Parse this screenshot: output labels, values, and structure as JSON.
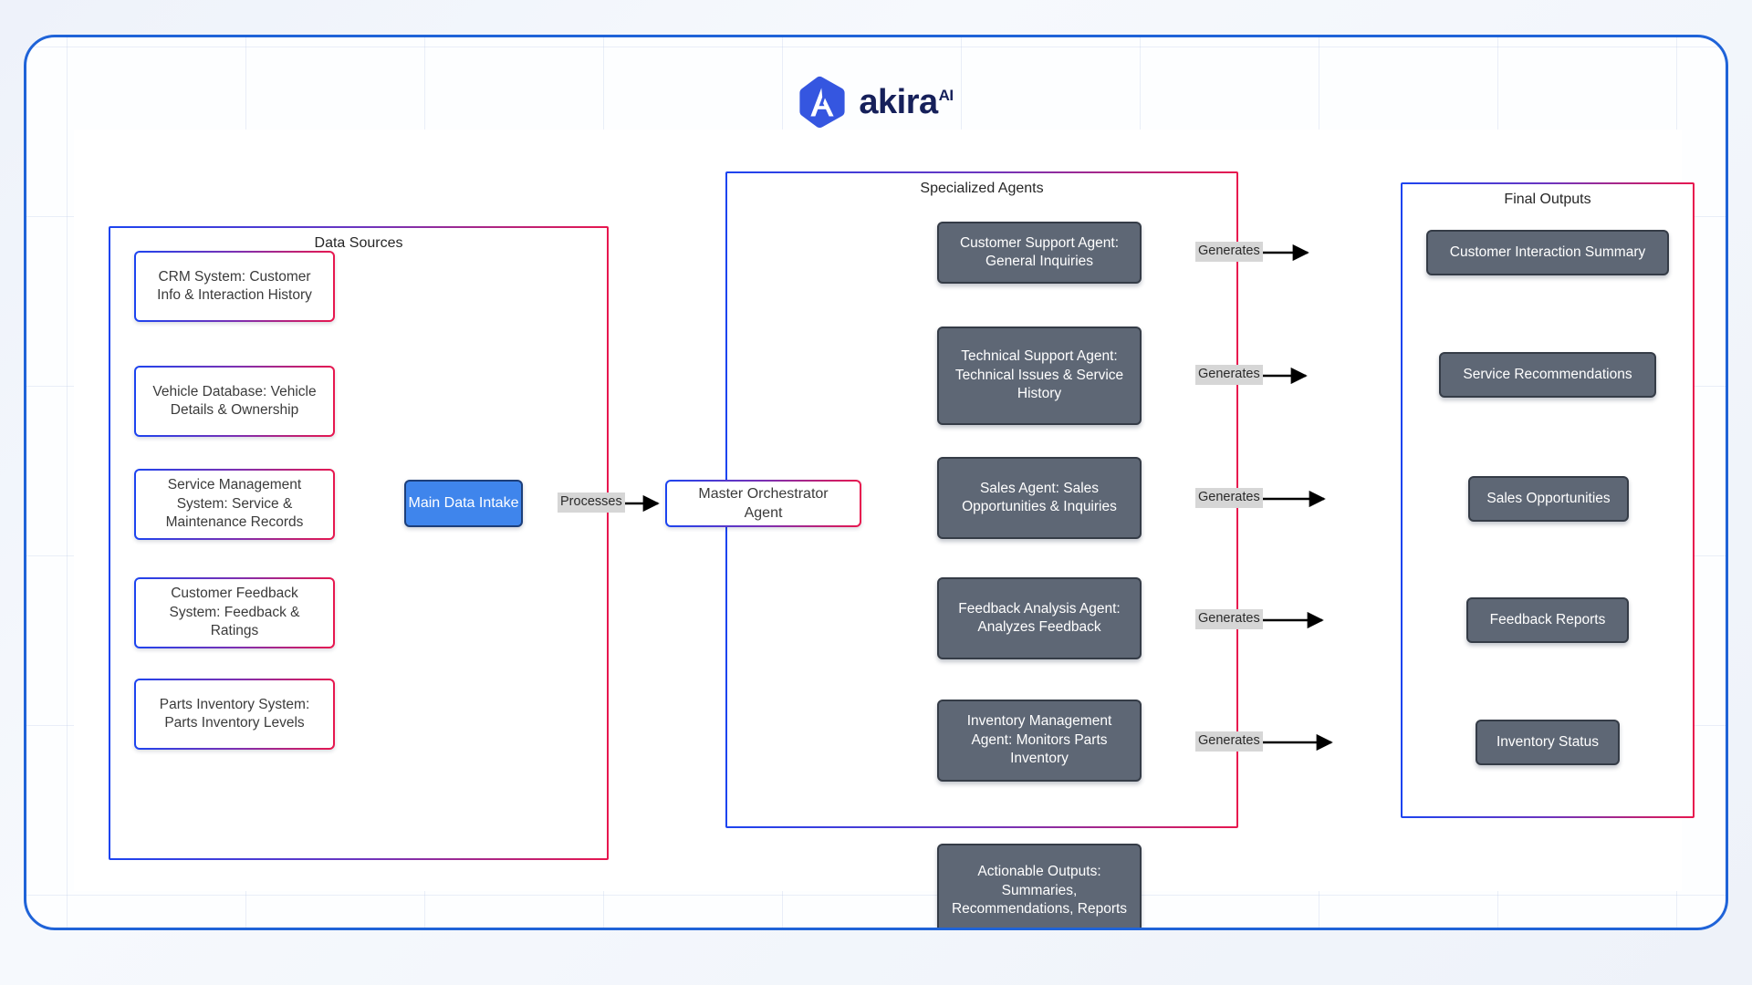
{
  "brand": {
    "name": "akira",
    "superscript": "AI",
    "mark_icon": "akira-hexagon-logo",
    "mark_color": "#3556e0",
    "text_color": "#16205a"
  },
  "theme": {
    "frame_border": "#1f63d8",
    "gradient_start": "#1c44f0",
    "gradient_end": "#e8174e",
    "intake_fill": "#3f85ec",
    "agent_fill": "#5e6775",
    "label_fill": "#d6d6d6",
    "canvas": "#ffffff"
  },
  "groups": {
    "data_sources": {
      "title": "Data Sources"
    },
    "specialized_agents": {
      "title": "Specialized Agents"
    },
    "final_outputs": {
      "title": "Final Outputs"
    }
  },
  "data_sources": [
    {
      "label": "CRM System: Customer Info & Interaction History"
    },
    {
      "label": "Vehicle Database: Vehicle Details & Ownership"
    },
    {
      "label": "Service Management System: Service & Maintenance Records"
    },
    {
      "label": "Customer Feedback System: Feedback & Ratings"
    },
    {
      "label": "Parts Inventory System: Parts Inventory Levels"
    }
  ],
  "intake": {
    "label": "Main Data Intake"
  },
  "orchestrator": {
    "label": "Master Orchestrator Agent"
  },
  "agents": [
    {
      "label": "Customer Support Agent: General Inquiries"
    },
    {
      "label": "Technical Support Agent: Technical Issues & Service History"
    },
    {
      "label": "Sales Agent: Sales Opportunities & Inquiries"
    },
    {
      "label": "Feedback Analysis Agent: Analyzes Feedback"
    },
    {
      "label": "Inventory Management Agent: Monitors Parts Inventory"
    }
  ],
  "outputs": [
    {
      "label": "Customer Interaction Summary"
    },
    {
      "label": "Service Recommendations"
    },
    {
      "label": "Sales Opportunities"
    },
    {
      "label": "Feedback Reports"
    },
    {
      "label": "Inventory Status"
    }
  ],
  "actionable_outputs": {
    "label": "Actionable Outputs: Summaries, Recommendations, Reports"
  },
  "edge_labels": {
    "processes": "Processes",
    "generates": [
      "Generates",
      "Generates",
      "Generates",
      "Generates",
      "Generates"
    ]
  }
}
